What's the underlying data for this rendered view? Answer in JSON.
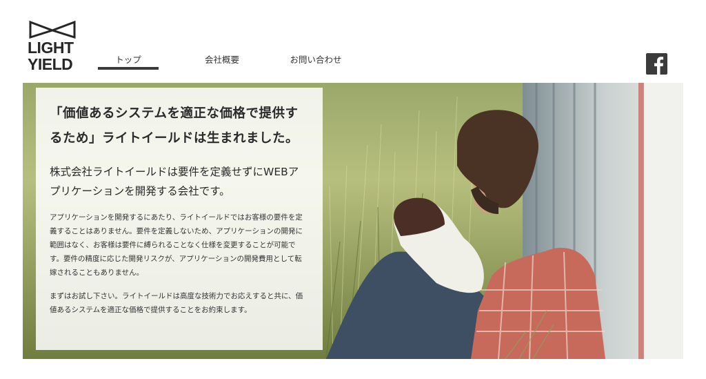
{
  "brand": {
    "logo_line1": "LIGHT",
    "logo_line2": "YIELD"
  },
  "nav": {
    "items": [
      {
        "label": "トップ",
        "active": true
      },
      {
        "label": "会社概要",
        "active": false
      },
      {
        "label": "お問い合わせ",
        "active": false
      }
    ]
  },
  "social": {
    "icon": "facebook-icon"
  },
  "hero": {
    "headline": "「価値あるシステムを適正な価格で提供するため」ライトイールドは生まれました。",
    "lead": "株式会社ライトイールドは要件を定義せずにWEBアプリケーションを開発する会社です。",
    "body": "アプリケーションを開発するにあたり、ライトイールドではお客様の要件を定義することはありません。要件を定義しないため、アプリケーションの開発に範囲はなく、お客様は要件に縛られることなく仕様を変更することが可能です。要件の精度に応じた開発リスクが、アプリケーションの開発費用として転嫁されることもありません。",
    "closing": "まずはお試し下さい。ライトイールドは高度な技術力でお応えすると共に、価値あるシステムを適正な価格で提供することをお約束します。"
  },
  "colors": {
    "nav_underline": "#3a3a3a",
    "icon_bg": "#3b3b3b",
    "panel_bg": "#ffffff"
  }
}
